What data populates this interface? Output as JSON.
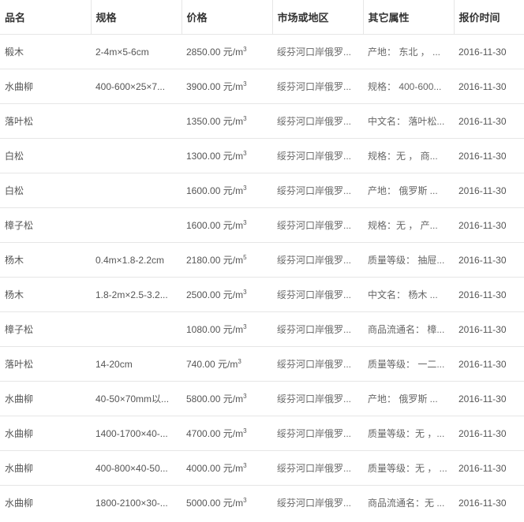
{
  "headers": [
    "品名",
    "规格",
    "价格",
    "市场或地区",
    "其它属性",
    "报价时间"
  ],
  "rows": [
    {
      "name": "椴木",
      "spec": "2-4m×5-6cm",
      "price": "2850.00",
      "unit": "元/m",
      "unit_sup": "3",
      "market": "绥芬河口岸俄罗...",
      "attrs": "产地： 东北 ， ...",
      "date": "2016-11-30"
    },
    {
      "name": "水曲柳",
      "spec": "400-600×25×7...",
      "price": "3900.00",
      "unit": "元/m",
      "unit_sup": "3",
      "market": "绥芬河口岸俄罗...",
      "attrs": "规格： 400-600...",
      "date": "2016-11-30"
    },
    {
      "name": "落叶松",
      "spec": "",
      "price": "1350.00",
      "unit": "元/m",
      "unit_sup": "3",
      "market": "绥芬河口岸俄罗...",
      "attrs": "中文名： 落叶松...",
      "date": "2016-11-30"
    },
    {
      "name": "白松",
      "spec": "",
      "price": "1300.00",
      "unit": "元/m",
      "unit_sup": "3",
      "market": "绥芬河口岸俄罗...",
      "attrs": "规格：无 ， 商...",
      "date": "2016-11-30"
    },
    {
      "name": "白松",
      "spec": "",
      "price": "1600.00",
      "unit": "元/m",
      "unit_sup": "3",
      "market": "绥芬河口岸俄罗...",
      "attrs": "产地： 俄罗斯 ...",
      "date": "2016-11-30"
    },
    {
      "name": "樟子松",
      "spec": "",
      "price": "1600.00",
      "unit": "元/m",
      "unit_sup": "3",
      "market": "绥芬河口岸俄罗...",
      "attrs": "规格：无 ， 产...",
      "date": "2016-11-30"
    },
    {
      "name": "杨木",
      "spec": "0.4m×1.8-2.2cm",
      "price": "2180.00",
      "unit": "元/m",
      "unit_sup": "5",
      "market": "绥芬河口岸俄罗...",
      "attrs": "质量等级： 抽屉...",
      "date": "2016-11-30"
    },
    {
      "name": "杨木",
      "spec": "1.8-2m×2.5-3.2...",
      "price": "2500.00",
      "unit": "元/m",
      "unit_sup": "3",
      "market": "绥芬河口岸俄罗...",
      "attrs": "中文名： 杨木 ...",
      "date": "2016-11-30"
    },
    {
      "name": "樟子松",
      "spec": "",
      "price": "1080.00",
      "unit": "元/m",
      "unit_sup": "3",
      "market": "绥芬河口岸俄罗...",
      "attrs": "商品流通名： 樟...",
      "date": "2016-11-30"
    },
    {
      "name": "落叶松",
      "spec": "14-20cm",
      "price": "740.00",
      "unit": "元/m",
      "unit_sup": "3",
      "market": "绥芬河口岸俄罗...",
      "attrs": "质量等级： 一二...",
      "date": "2016-11-30"
    },
    {
      "name": "水曲柳",
      "spec": "40-50×70mm以...",
      "price": "5800.00",
      "unit": "元/m",
      "unit_sup": "3",
      "market": "绥芬河口岸俄罗...",
      "attrs": "产地： 俄罗斯 ...",
      "date": "2016-11-30"
    },
    {
      "name": "水曲柳",
      "spec": "1400-1700×40-...",
      "price": "4700.00",
      "unit": "元/m",
      "unit_sup": "3",
      "market": "绥芬河口岸俄罗...",
      "attrs": "质量等级：无 ，...",
      "date": "2016-11-30"
    },
    {
      "name": "水曲柳",
      "spec": "400-800×40-50...",
      "price": "4000.00",
      "unit": "元/m",
      "unit_sup": "3",
      "market": "绥芬河口岸俄罗...",
      "attrs": "质量等级：无 ， ...",
      "date": "2016-11-30"
    },
    {
      "name": "水曲柳",
      "spec": "1800-2100×30-...",
      "price": "5000.00",
      "unit": "元/m",
      "unit_sup": "3",
      "market": "绥芬河口岸俄罗...",
      "attrs": "商品流通名：无 ...",
      "date": "2016-11-30"
    }
  ]
}
